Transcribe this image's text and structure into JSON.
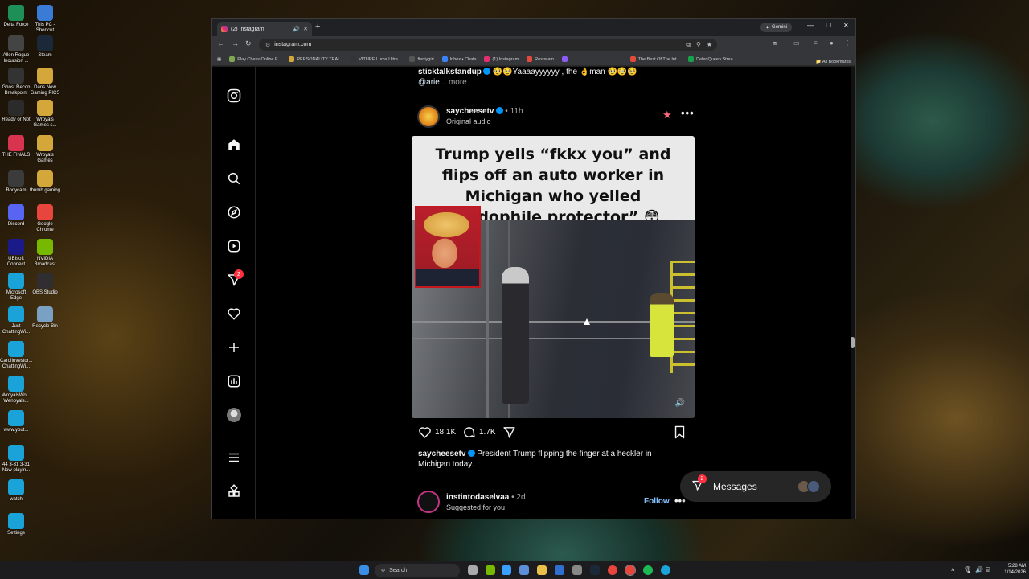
{
  "desktop": {
    "icons": [
      {
        "label": "Delta Force",
        "color": "#1d8f57"
      },
      {
        "label": "This PC - Shortcut",
        "color": "#3a7bd5"
      },
      {
        "label": "Allen Rogue Incursion ...",
        "color": "#444"
      },
      {
        "label": "Steam",
        "color": "#1b2838"
      },
      {
        "label": "Ghost Recon Breakpoint",
        "color": "#333"
      },
      {
        "label": "Dans New Gaming PICS",
        "color": "#d4a73a"
      },
      {
        "label": "Ready or Not",
        "color": "#2b2b2b"
      },
      {
        "label": "Wroyals Games s...",
        "color": "#d4a73a"
      },
      {
        "label": "THE FINALS",
        "color": "#d8344f"
      },
      {
        "label": "Wroyals Games",
        "color": "#d4a73a"
      },
      {
        "label": "Bodycam",
        "color": "#3b3b3b"
      },
      {
        "label": "thumb gaming",
        "color": "#d4a73a"
      },
      {
        "label": "Discord",
        "color": "#5865f2"
      },
      {
        "label": "Google Chrome",
        "color": "#e8453c"
      },
      {
        "label": "UBIsoft Connect",
        "color": "#1a1a8a"
      },
      {
        "label": "NVIDIA Broadcast",
        "color": "#76b900"
      },
      {
        "label": "Microsoft Edge",
        "color": "#1aa3d8"
      },
      {
        "label": "OBS Studio",
        "color": "#302e31"
      },
      {
        "label": "Just ChattingWi...",
        "color": "#1aa3d8"
      },
      {
        "label": "Recycle Bin",
        "color": "#7aa0c4"
      },
      {
        "label": "CarolInvestor... ChattingWi...",
        "color": "#1aa3d8"
      },
      {
        "label": "WroyalsWo... Wenoyals...",
        "color": "#1aa3d8"
      },
      {
        "label": "www.yout...",
        "color": "#1aa3d8"
      },
      {
        "label": "44 3-31 3-31 Now playin...",
        "color": "#1aa3d8"
      },
      {
        "label": "watch",
        "color": "#1aa3d8"
      },
      {
        "label": "Settings",
        "color": "#1aa3d8"
      }
    ]
  },
  "browser": {
    "tab_title": "(2) Instagram",
    "new_tab_glyph": "+",
    "gemini_label": "Gemini",
    "url": "instagram.com",
    "bookmarks": [
      "Play Chess Online F...",
      "PERSONALITY TRAI...",
      "VITURE Luma Ultra...",
      "fieniygirl",
      "Inbox • Chats",
      "(1) Instagram",
      "Restream",
      "...",
      "The Best Of The Int...",
      "DelenQueen Strea..."
    ],
    "all_bookmarks": "All Bookmarks"
  },
  "instagram": {
    "sidebar_badge": "2",
    "prev_post": {
      "user": "sticktalkstandup",
      "caption": " 🥹🥹Yaaaayyyyyy , the 👌man 🥹🥹🥹",
      "mention": "@arie",
      "more": "... more"
    },
    "post": {
      "user": "saycheesetv",
      "time": "11h",
      "audio": "Original audio",
      "media_caption": "Trump yells “fkkx you” and flips off an auto worker in Michigan who yelled “pedophile protector” 😳",
      "likes": "18.1K",
      "comments": "1.7K",
      "caption_user": "saycheesetv",
      "caption_text": "President Trump flipping the finger at a heckler in Michigan today."
    },
    "suggested": {
      "user": "instintodaselvaa",
      "time": "2d",
      "subtitle": "Suggested for you",
      "follow": "Follow"
    },
    "messages": {
      "label": "Messages",
      "badge": "2"
    }
  },
  "taskbar": {
    "search_placeholder": "Search",
    "time": "5:28 AM",
    "date": "1/14/2026"
  }
}
